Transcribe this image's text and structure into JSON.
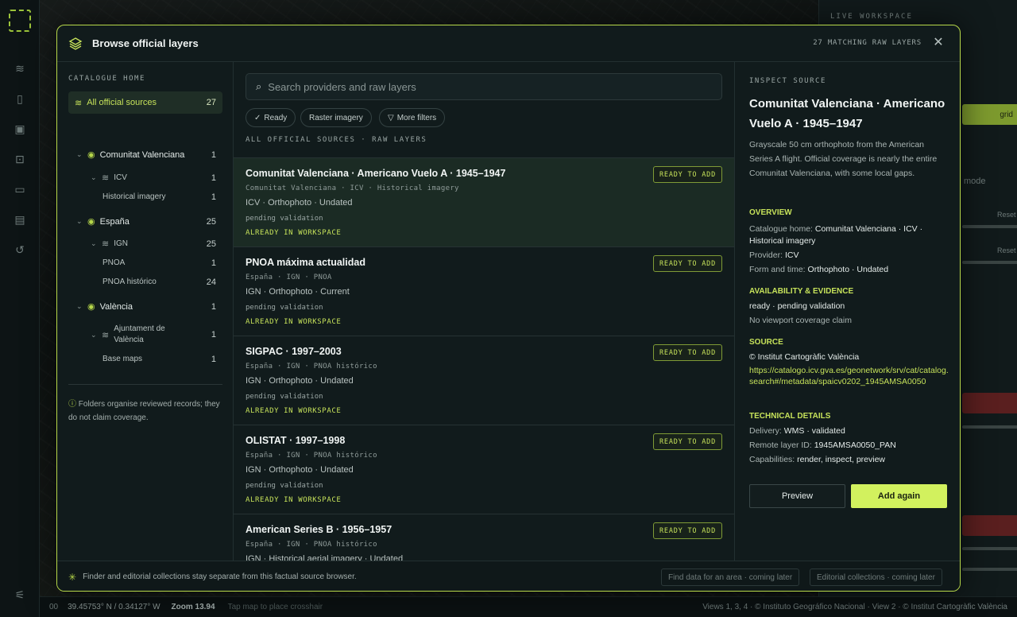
{
  "background": {
    "live_workspace": "LIVE WORKSPACE",
    "right_hint_text": "mode",
    "reset_1": "Reset",
    "reset_2": "Reset",
    "grid_button": "grid",
    "status": {
      "left_code": "00",
      "coords": "39.45753° N / 0.34127° W",
      "zoom": "Zoom 13.94",
      "hint": "Tap map to place crosshair",
      "attribution": "Views 1, 3, 4 · © Instituto Geográfico Nacional · View 2 · © Institut Cartogràfic València"
    }
  },
  "modal": {
    "title": "Browse official layers",
    "matching": "27 MATCHING RAW LAYERS",
    "left": {
      "section": "CATALOGUE HOME",
      "all_sources": {
        "label": "All official sources",
        "count": "27"
      },
      "tree": [
        {
          "label": "Comunitat Valenciana",
          "count": "1"
        },
        {
          "label": "ICV",
          "count": "1"
        },
        {
          "label": "Historical imagery",
          "count": "1"
        },
        {
          "label": "España",
          "count": "25"
        },
        {
          "label": "IGN",
          "count": "25"
        },
        {
          "label": "PNOA",
          "count": "1"
        },
        {
          "label": "PNOA histórico",
          "count": "24"
        },
        {
          "label": "València",
          "count": "1"
        },
        {
          "label": "Ajuntament de València",
          "count": "1"
        },
        {
          "label": "Base maps",
          "count": "1"
        }
      ],
      "note": "Folders organise reviewed records; they do not claim coverage."
    },
    "search_placeholder": "Search providers and raw layers",
    "chips": [
      "Ready",
      "Raster imagery",
      "More filters"
    ],
    "list_label": "ALL OFFICIAL SOURCES · RAW LAYERS",
    "results": [
      {
        "title": "Comunitat Valenciana · Americano Vuelo A · 1945–1947",
        "meta": "Comunitat Valenciana · ICV · Historical imagery",
        "format": "ICV · Orthophoto · Undated",
        "status": "pending validation",
        "workspace": "ALREADY IN WORKSPACE",
        "badge": "READY TO ADD"
      },
      {
        "title": "PNOA máxima actualidad",
        "meta": "España · IGN · PNOA",
        "format": "IGN · Orthophoto · Current",
        "status": "pending validation",
        "workspace": "ALREADY IN WORKSPACE",
        "badge": "READY TO ADD"
      },
      {
        "title": "SIGPAC · 1997–2003",
        "meta": "España · IGN · PNOA histórico",
        "format": "IGN · Orthophoto · Undated",
        "status": "pending validation",
        "workspace": "ALREADY IN WORKSPACE",
        "badge": "READY TO ADD"
      },
      {
        "title": "OLISTAT · 1997–1998",
        "meta": "España · IGN · PNOA histórico",
        "format": "IGN · Orthophoto · Undated",
        "status": "pending validation",
        "workspace": "ALREADY IN WORKSPACE",
        "badge": "READY TO ADD"
      },
      {
        "title": "American Series B · 1956–1957",
        "meta": "España · IGN · PNOA histórico",
        "format": "IGN · Historical aerial imagery · Undated",
        "status": "",
        "workspace": "",
        "badge": "READY TO ADD"
      }
    ],
    "inspect": {
      "label": "INSPECT SOURCE",
      "title": "Comunitat Valenciana · Americano Vuelo A · 1945–1947",
      "description": "Grayscale 50 cm orthophoto from the American Series A flight. Official coverage is nearly the entire Comunitat Valenciana, with some local gaps.",
      "overview_h": "OVERVIEW",
      "catalogue_home_k": "Catalogue home:",
      "catalogue_home_v": "Comunitat Valenciana · ICV · Historical imagery",
      "provider_k": "Provider:",
      "provider_v": "ICV",
      "form_k": "Form and time:",
      "form_v": "Orthophoto · Undated",
      "availability_h": "AVAILABILITY & EVIDENCE",
      "availability_1": "ready · pending validation",
      "availability_2": "No viewport coverage claim",
      "source_h": "SOURCE",
      "source_credit": "© Institut Cartogràfic València",
      "source_url": "https://catalogo.icv.gva.es/geonetwork/srv/cat/catalog.search#/metadata/spaicv0202_1945AMSA0050",
      "tech_h": "TECHNICAL DETAILS",
      "delivery_k": "Delivery:",
      "delivery_v": "WMS · validated",
      "remote_k": "Remote layer ID:",
      "remote_v": "1945AMSA0050_PAN",
      "cap_k": "Capabilities:",
      "cap_v": "render, inspect, preview",
      "preview_btn": "Preview",
      "add_btn": "Add again"
    },
    "footer": {
      "text": "Finder and editorial collections stay separate from this factual source browser.",
      "btn1": "Find data for an area · coming later",
      "btn2": "Editorial collections · coming later"
    }
  },
  "colors": {
    "accent": "#c6e25a",
    "border": "#b8d94a",
    "panel": "#111b1c"
  }
}
